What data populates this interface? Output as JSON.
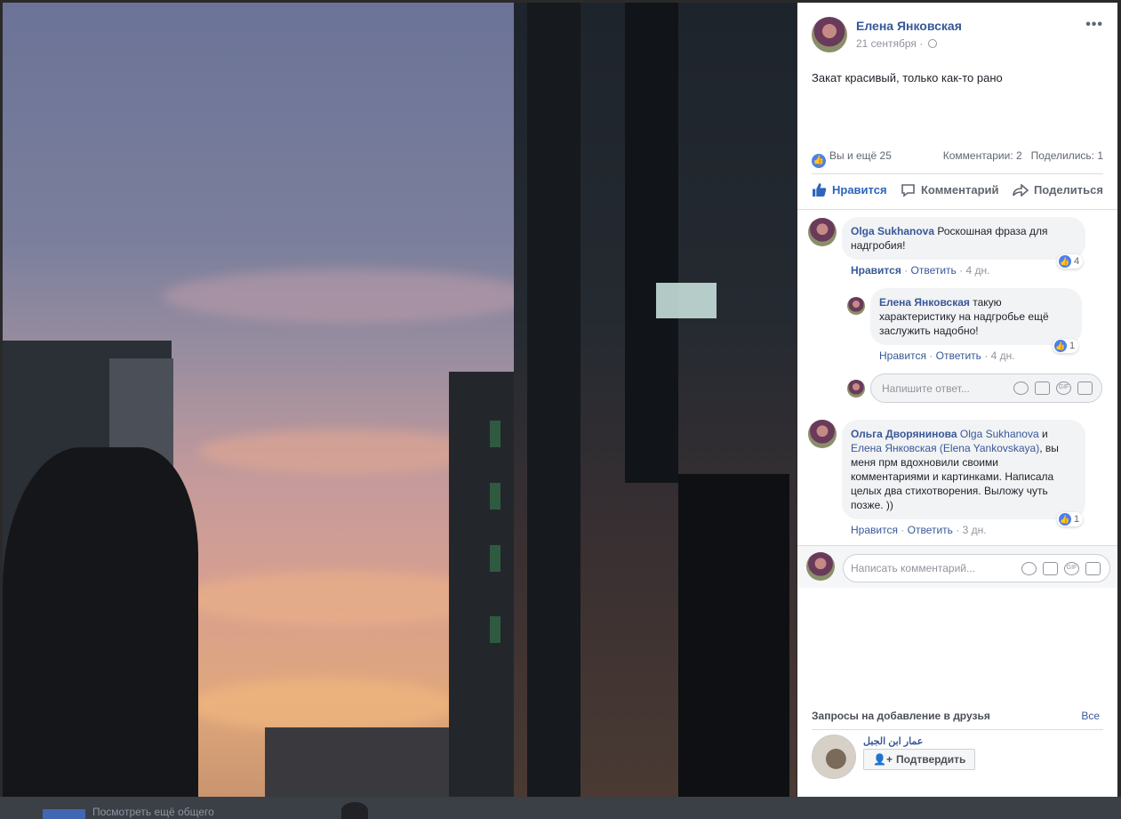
{
  "post": {
    "author": "Елена Янковская",
    "date": "21 сентября ·",
    "text": "Закат красивый, только как-то рано",
    "more_icon": "more-options-icon"
  },
  "reactions": {
    "likes_text": "Вы и ещё 25",
    "comments_count": "Комментарии: 2",
    "shares_count": "Поделились: 1"
  },
  "actions": {
    "like": "Нравится",
    "comment": "Комментарий",
    "share": "Поделиться"
  },
  "comments": [
    {
      "author": "Olga Sukhanova",
      "text": "Роскошная фраза для надгробия!",
      "like_label": "Нравится",
      "reply_label": "Ответить",
      "age": "4 дн.",
      "reactions": "4"
    },
    {
      "author": "Елена Янковская",
      "text": "такую характеристику на надгробье ещё заслужить надобно!",
      "like_label": "Нравится",
      "reply_label": "Ответить",
      "age": "4 дн.",
      "reactions": "1"
    },
    {
      "author": "Ольга Дворянинова",
      "mention1": "Olga Sukhanova",
      "and": "и",
      "mention2": "Елена Янковская (Elena Yankovskaya)",
      "text": ", вы меня прм вдохновили своими комментариями и картинками. Написала целых два стихотворения. Выложу чуть позже. ))",
      "like_label": "Нравится",
      "reply_label": "Ответить",
      "age": "3 дн.",
      "reactions": "1"
    }
  ],
  "reply_input": {
    "placeholder": "Напишите ответ..."
  },
  "comment_input": {
    "placeholder": "Написать комментарий..."
  },
  "friends": {
    "title": "Запросы на добавление в друзья",
    "see_all": "Все",
    "request_name": "عمار ابن الجبل",
    "confirm_label": "Подтвердить"
  },
  "bottom_strip": {
    "text": "Посмотреть ещё общего"
  },
  "colors": {
    "link": "#385898",
    "accent": "#4267b2",
    "like_blue": "#2d64bc"
  }
}
